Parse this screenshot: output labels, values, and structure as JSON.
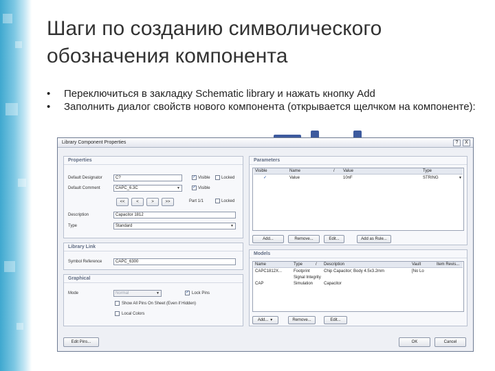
{
  "slide": {
    "title": "Шаги по созданию символического обозначения компонента",
    "bullets": [
      "Переключиться в закладку Schematic library и нажать кнопку Add",
      "Заполнить диалог свойств нового компонента (открывается щелчком на компоненте):"
    ],
    "bullet_glyph": "•"
  },
  "dialog": {
    "title": "Library Component Properties",
    "title_buttons": {
      "help": "?",
      "close": "X"
    },
    "properties": {
      "heading": "Properties",
      "default_designator_label": "Default Designator",
      "default_designator_value": "C?",
      "default_comment_label": "Default Comment",
      "default_comment_value": "CAPC_6.3C",
      "visible_label": "Visible",
      "locked_label": "Locked",
      "part_label": "Part 1/1",
      "nav_buttons": [
        "<<",
        "<",
        ">",
        ">>"
      ],
      "description_label": "Description",
      "description_value": "Capacitor 1812",
      "type_label": "Type",
      "type_value": "Standard"
    },
    "library_link": {
      "heading": "Library Link",
      "symbol_reference_label": "Symbol Reference",
      "symbol_reference_value": "CAPC_6300"
    },
    "graphical": {
      "heading": "Graphical",
      "mode_label": "Mode",
      "mode_value": "Normal",
      "lock_pins_label": "Lock Pins",
      "show_all_pins_label": "Show All Pins On Sheet (Even if Hidden)",
      "local_colors_label": "Local Colors"
    },
    "parameters": {
      "heading": "Parameters",
      "columns": [
        "Visible",
        "Name",
        "/",
        "Value",
        "Type"
      ],
      "rows": [
        {
          "visible": "✓",
          "name": "Value",
          "value": "10nF",
          "type": "STRING"
        }
      ],
      "buttons": [
        "Add...",
        "Remove...",
        "Edit...",
        "Add as Rule..."
      ]
    },
    "models": {
      "heading": "Models",
      "columns": [
        "Name",
        "Type",
        "/",
        "Description",
        "Vault",
        "Item Revis..."
      ],
      "rows": [
        {
          "name": "CAPC1812X...",
          "type": "Footprint",
          "description": "Chip Capacitor; Body 4.5x3.2mm",
          "vault": "[No Lo"
        },
        {
          "name": "",
          "type": "Signal Integrity",
          "description": "",
          "vault": ""
        },
        {
          "name": "CAP",
          "type": "Simulation",
          "description": "Capacitor",
          "vault": ""
        }
      ],
      "buttons": [
        "Add...",
        "Remove...",
        "Edit..."
      ]
    },
    "footer": {
      "edit_pins_label": "Edit Pins...",
      "ok_label": "OK",
      "cancel_label": "Cancel"
    }
  },
  "colors": {
    "sidebar": "#3fa8cf",
    "dialog_background": "#eef0f5",
    "group_heading": "#5f6b82",
    "background_artifact": "#3d5a9e"
  }
}
